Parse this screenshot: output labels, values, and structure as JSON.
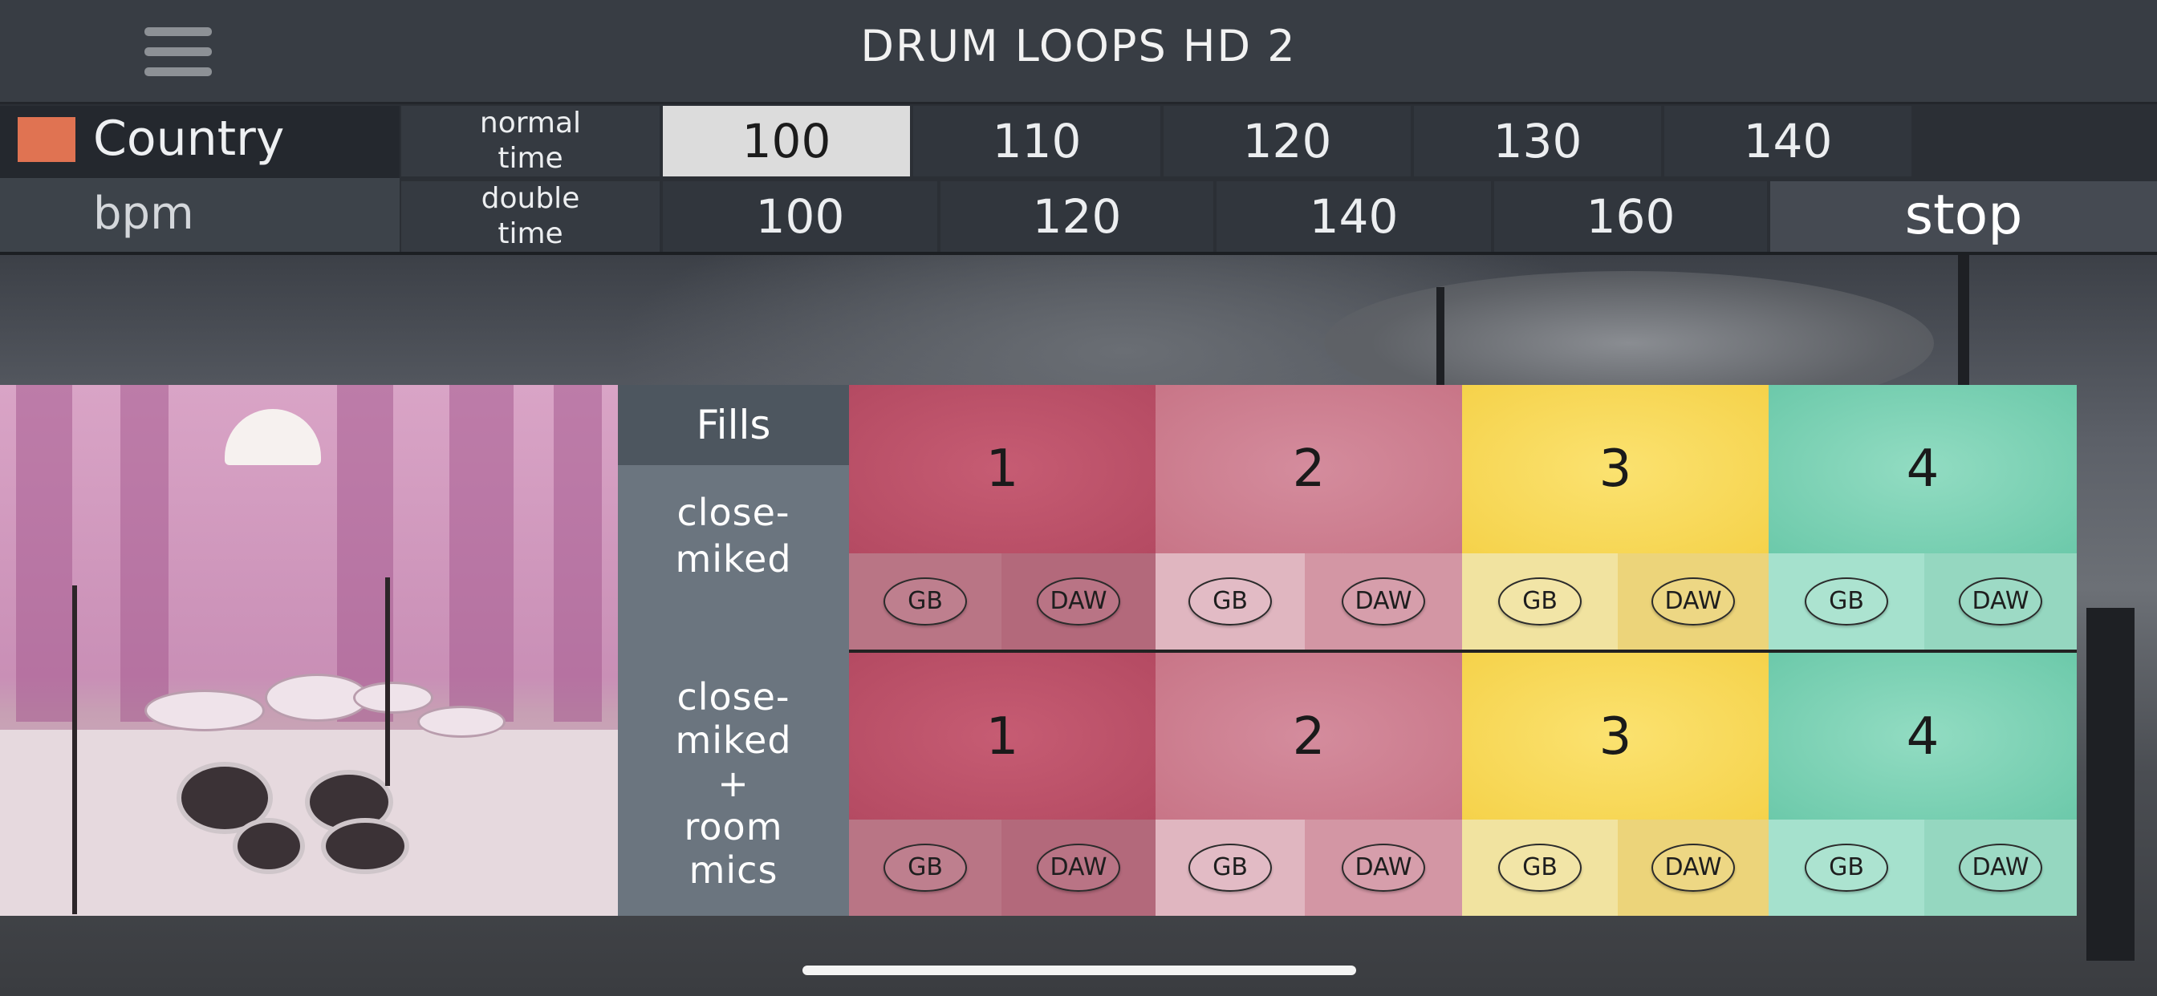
{
  "header": {
    "title": "DRUM LOOPS HD 2",
    "menu_icon": "hamburger-menu-icon"
  },
  "bpmbar": {
    "genre": {
      "label": "Country",
      "color": "#e07352"
    },
    "bpm_label": "bpm",
    "normal": {
      "label_line1": "normal",
      "label_line2": "time",
      "tempos": [
        "100",
        "110",
        "120",
        "130",
        "140"
      ],
      "selected": "100"
    },
    "double": {
      "label_line1": "double",
      "label_line2": "time",
      "tempos": [
        "100",
        "120",
        "140",
        "160"
      ]
    },
    "stop_label": "stop"
  },
  "panel": {
    "fills_label": "Fills",
    "row1_label": "close-\nmiked",
    "row2_label": "close-\nmiked\n+\nroom\nmics",
    "pad_colors": [
      "#c2536b",
      "#cf8093",
      "#f8dc58",
      "#7fd2b6"
    ],
    "rows": [
      {
        "pads": [
          "1",
          "2",
          "3",
          "4"
        ]
      },
      {
        "pads": [
          "1",
          "2",
          "3",
          "4"
        ]
      }
    ],
    "button_gb": "GB",
    "button_daw": "DAW"
  }
}
